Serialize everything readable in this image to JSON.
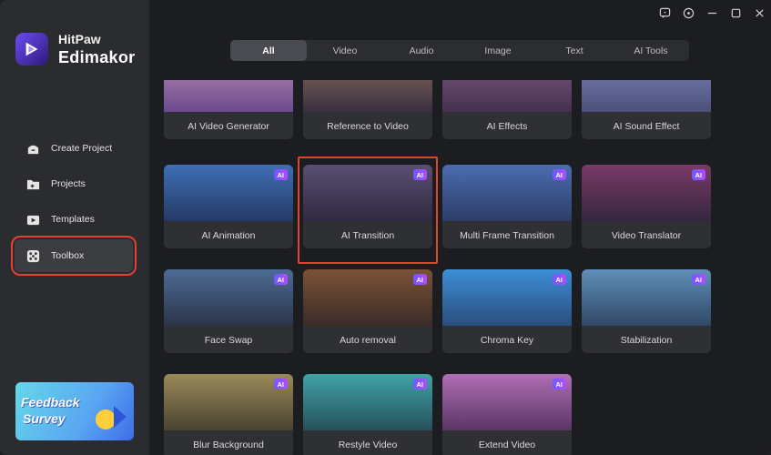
{
  "app": {
    "brand_top": "HitPaw",
    "brand_main": "Edimakor"
  },
  "sidebar": {
    "items": [
      {
        "label": "Create Project",
        "icon": "create-project-icon"
      },
      {
        "label": "Projects",
        "icon": "folder-icon"
      },
      {
        "label": "Templates",
        "icon": "templates-icon"
      },
      {
        "label": "Toolbox",
        "icon": "toolbox-icon",
        "active": true
      }
    ],
    "feedback": {
      "line1": "Feedback",
      "line2": "Survey"
    }
  },
  "window": {
    "buttons": [
      "feedback-icon",
      "info-icon",
      "minimize-icon",
      "maximize-icon",
      "close-icon"
    ]
  },
  "tabs": [
    {
      "label": "All",
      "active": true
    },
    {
      "label": "Video"
    },
    {
      "label": "Audio"
    },
    {
      "label": "Image"
    },
    {
      "label": "Text"
    },
    {
      "label": "AI Tools"
    }
  ],
  "badge_text": "AI",
  "cards": [
    {
      "label": "AI Video Generator",
      "ai": false
    },
    {
      "label": "Reference to Video",
      "ai": false
    },
    {
      "label": "AI Effects",
      "ai": false
    },
    {
      "label": "AI Sound Effect",
      "ai": false
    },
    {
      "label": "AI Animation",
      "ai": true
    },
    {
      "label": "AI Transition",
      "ai": true,
      "highlighted": true
    },
    {
      "label": "Multi Frame Transition",
      "ai": true
    },
    {
      "label": "Video Translator",
      "ai": true
    },
    {
      "label": "Face Swap",
      "ai": true
    },
    {
      "label": "Auto removal",
      "ai": true
    },
    {
      "label": "Chroma Key",
      "ai": true
    },
    {
      "label": "Stabilization",
      "ai": true
    },
    {
      "label": "Blur Background",
      "ai": true
    },
    {
      "label": "Restyle Video",
      "ai": true
    },
    {
      "label": "Extend Video",
      "ai": true
    }
  ],
  "colors": {
    "accent": "#6e5bff",
    "highlight": "#e2432f",
    "sidebar": "#2b2c2f",
    "background": "#1c1d20"
  }
}
